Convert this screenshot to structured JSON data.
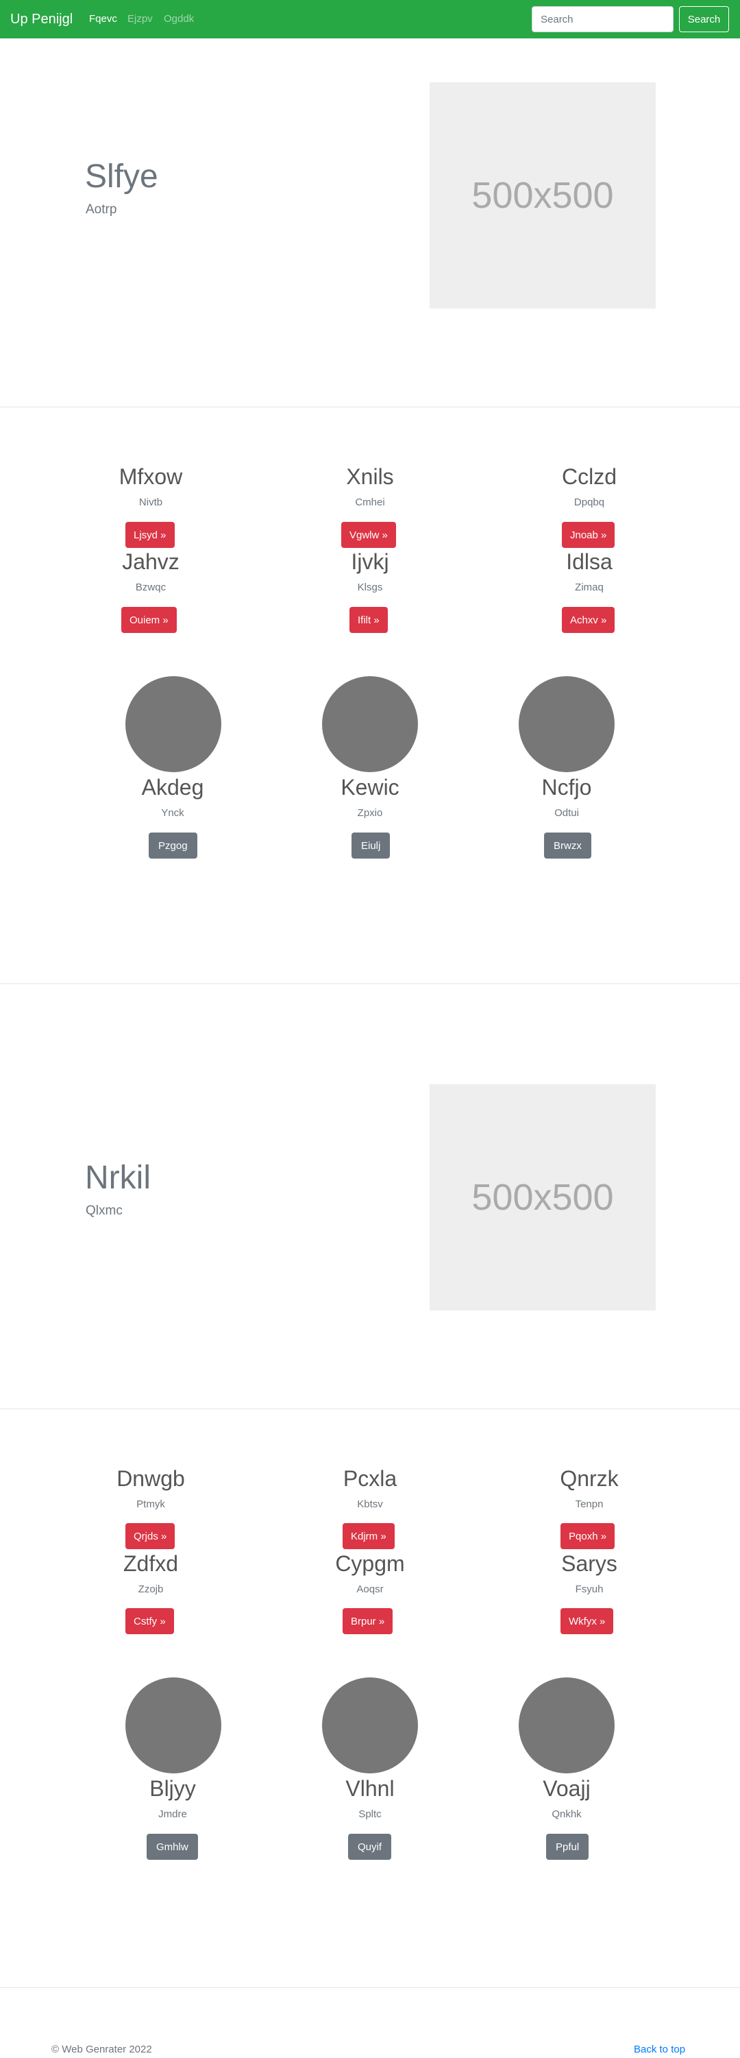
{
  "navbar": {
    "brand": "Up Penijgl",
    "links": [
      "Fqevc",
      "Ejzpv",
      "Ogddk"
    ],
    "search_placeholder": "Search",
    "search_button": "Search"
  },
  "hero1": {
    "title": "Slfye",
    "subtitle": "Aotrp",
    "image_label": "500x500"
  },
  "features1": [
    {
      "title": "Mfxow",
      "sub": "Nivtb",
      "button": "Ljsyd »"
    },
    {
      "title": "Xnils",
      "sub": "Cmhei",
      "button": "Vgwlw »"
    },
    {
      "title": "Cclzd",
      "sub": "Dpqbq",
      "button": "Jnoab »"
    },
    {
      "title": "Jahvz",
      "sub": "Bzwqc",
      "button": "Ouiem »"
    },
    {
      "title": "Ijvkj",
      "sub": "Klsgs",
      "button": "Ifilt »"
    },
    {
      "title": "Idlsa",
      "sub": "Zimaq",
      "button": "Achxv »"
    }
  ],
  "people1": [
    {
      "name": "Akdeg",
      "sub": "Ynck",
      "button": "Pzgog"
    },
    {
      "name": "Kewic",
      "sub": "Zpxio",
      "button": "Eiulj"
    },
    {
      "name": "Ncfjo",
      "sub": "Odtui",
      "button": "Brwzx"
    }
  ],
  "hero2": {
    "title": "Nrkil",
    "subtitle": "Qlxmc",
    "image_label": "500x500"
  },
  "features2": [
    {
      "title": "Dnwgb",
      "sub": "Ptmyk",
      "button": "Qrjds »"
    },
    {
      "title": "Pcxla",
      "sub": "Kbtsv",
      "button": "Kdjrm »"
    },
    {
      "title": "Qnrzk",
      "sub": "Tenpn",
      "button": "Pqoxh »"
    },
    {
      "title": "Zdfxd",
      "sub": "Zzojb",
      "button": "Cstfy »"
    },
    {
      "title": "Cypgm",
      "sub": "Aoqsr",
      "button": "Brpur »"
    },
    {
      "title": "Sarys",
      "sub": "Fsyuh",
      "button": "Wkfyx »"
    }
  ],
  "people2": [
    {
      "name": "Bljyy",
      "sub": "Jmdre",
      "button": "Gmhlw"
    },
    {
      "name": "Vlhnl",
      "sub": "Spltc",
      "button": "Quyif"
    },
    {
      "name": "Voajj",
      "sub": "Qnkhk",
      "button": "Ppful"
    }
  ],
  "footer": {
    "copyright": "© Web Genrater 2022",
    "back_to_top": "Back to top"
  }
}
